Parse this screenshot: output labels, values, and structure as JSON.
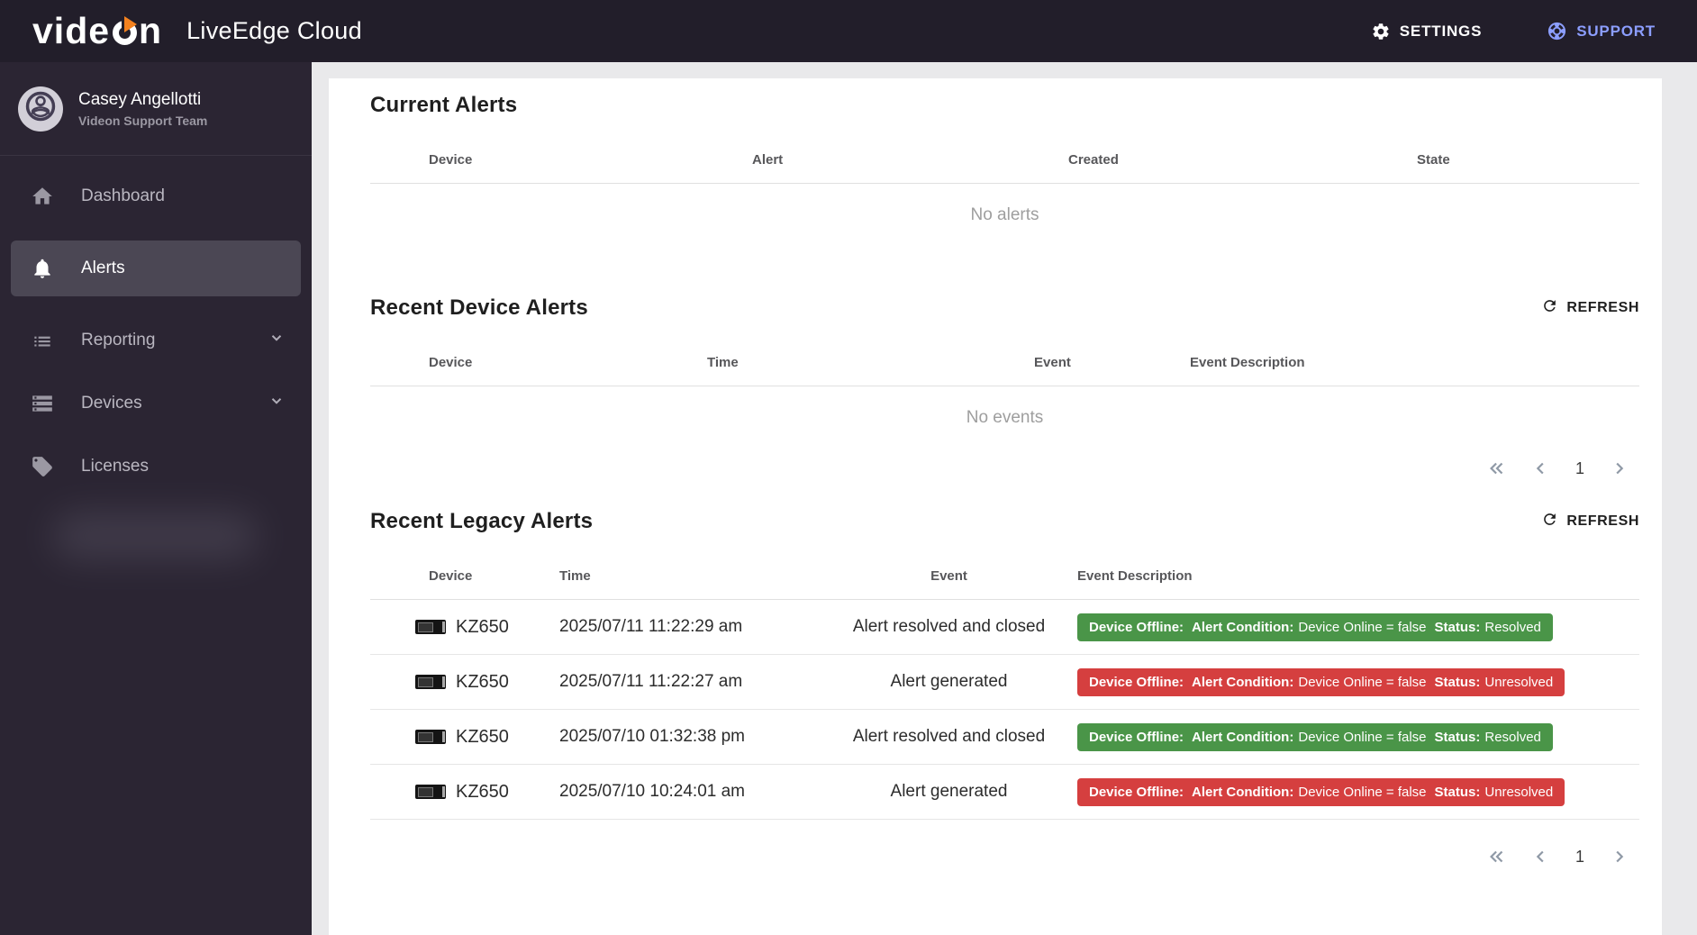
{
  "colors": {
    "badge_resolved": "#4a9548",
    "badge_unresolved": "#d53f3f",
    "support_accent": "#8c9eff",
    "logo_accent": "#f5821f"
  },
  "header": {
    "logo_prefix": "vide",
    "logo_suffix": "n",
    "app_name": "LiveEdge Cloud",
    "settings_label": "SETTINGS",
    "support_label": "SUPPORT"
  },
  "sidebar": {
    "user": {
      "name": "Casey Angellotti",
      "team": "Videon Support Team"
    },
    "items": [
      {
        "label": "Dashboard"
      },
      {
        "label": "Alerts"
      },
      {
        "label": "Reporting"
      },
      {
        "label": "Devices"
      },
      {
        "label": "Licenses"
      }
    ]
  },
  "main": {
    "current_alerts": {
      "title": "Current Alerts",
      "columns": [
        "Device",
        "Alert",
        "Created",
        "State"
      ],
      "empty_text": "No alerts"
    },
    "recent_device_alerts": {
      "title": "Recent Device Alerts",
      "refresh_label": "REFRESH",
      "columns": [
        "Device",
        "Time",
        "Event",
        "Event Description"
      ],
      "empty_text": "No events",
      "pagination": {
        "page": "1"
      }
    },
    "recent_legacy_alerts": {
      "title": "Recent Legacy Alerts",
      "refresh_label": "REFRESH",
      "columns": [
        "Device",
        "Time",
        "Event",
        "Event Description"
      ],
      "pagination": {
        "page": "1"
      },
      "rows": [
        {
          "device": "KZ650",
          "time": "2025/07/11 11:22:29 am",
          "event": "Alert resolved and closed",
          "status": "Resolved",
          "badge": {
            "alert_label": "Device Offline:",
            "condition_label": "Alert Condition:",
            "condition_value": "Device Online = false",
            "status_label": "Status:"
          }
        },
        {
          "device": "KZ650",
          "time": "2025/07/11 11:22:27 am",
          "event": "Alert generated",
          "status": "Unresolved",
          "badge": {
            "alert_label": "Device Offline:",
            "condition_label": "Alert Condition:",
            "condition_value": "Device Online = false",
            "status_label": "Status:"
          }
        },
        {
          "device": "KZ650",
          "time": "2025/07/10 01:32:38 pm",
          "event": "Alert resolved and closed",
          "status": "Resolved",
          "badge": {
            "alert_label": "Device Offline:",
            "condition_label": "Alert Condition:",
            "condition_value": "Device Online = false",
            "status_label": "Status:"
          }
        },
        {
          "device": "KZ650",
          "time": "2025/07/10 10:24:01 am",
          "event": "Alert generated",
          "status": "Unresolved",
          "badge": {
            "alert_label": "Device Offline:",
            "condition_label": "Alert Condition:",
            "condition_value": "Device Online = false",
            "status_label": "Status:"
          }
        }
      ]
    }
  }
}
